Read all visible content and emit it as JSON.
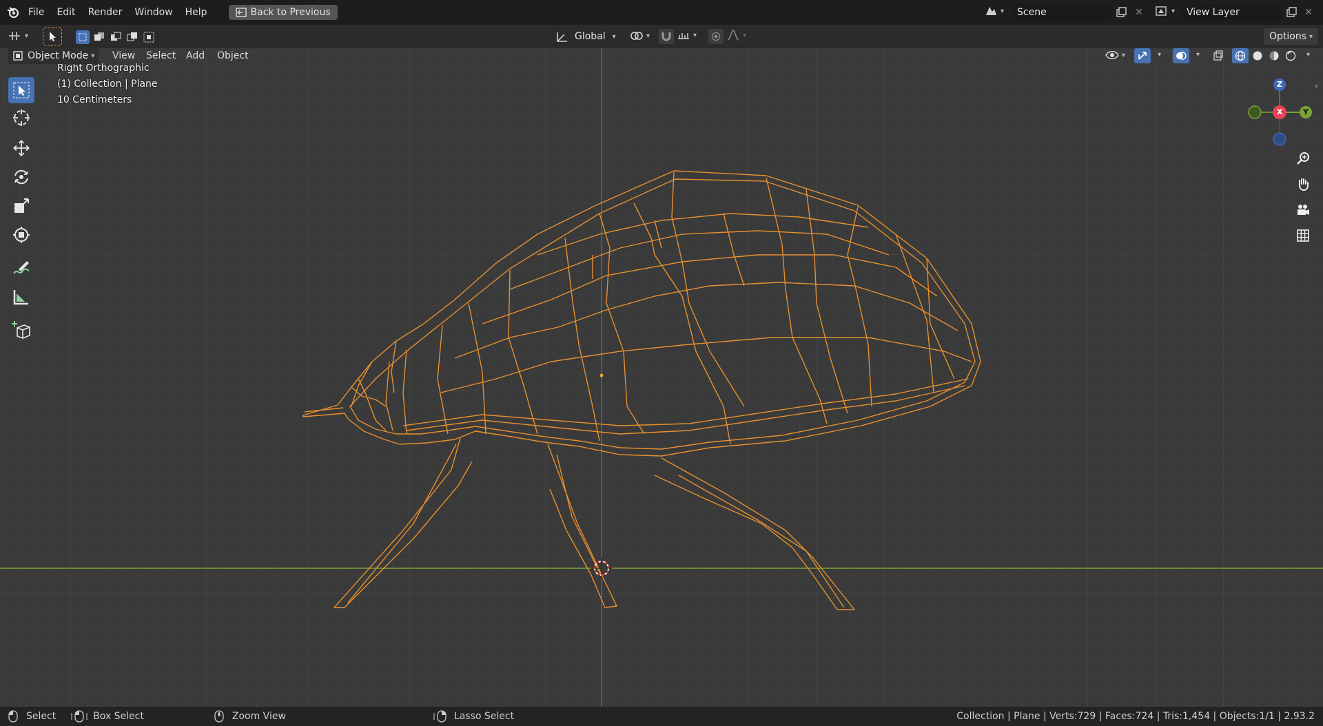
{
  "topbar": {
    "menus": [
      "File",
      "Edit",
      "Render",
      "Window",
      "Help"
    ],
    "back_button": "Back to Previous",
    "scene": "Scene",
    "view_layer": "View Layer"
  },
  "toolbar": {
    "orientation": "Global",
    "options": "Options"
  },
  "header": {
    "mode": "Object Mode",
    "menus": [
      "View",
      "Select",
      "Add",
      "Object"
    ]
  },
  "viewport": {
    "view_name": "Right Orthographic",
    "collection_info": "(1) Collection | Plane",
    "scale": "10 Centimeters",
    "axes": {
      "z": "Z",
      "x": "X",
      "y": "Y"
    },
    "mesh_color": "#e8902f",
    "grid_color": "#424242",
    "x_axis_color": "#7ba23a",
    "z_axis_color": "#3d6bb3"
  },
  "tools": [
    "select-box-icon",
    "cursor-icon",
    "move-icon",
    "rotate-icon",
    "scale-icon",
    "transform-icon",
    "annotate-icon",
    "measure-icon",
    "add-cube-icon"
  ],
  "status": {
    "select": "Select",
    "box_select": "Box Select",
    "zoom_view": "Zoom View",
    "lasso_select": "Lasso Select",
    "stats": "Collection | Plane | Verts:729 | Faces:724 | Tris:1,454 | Objects:1/1 | 2.93.2"
  }
}
